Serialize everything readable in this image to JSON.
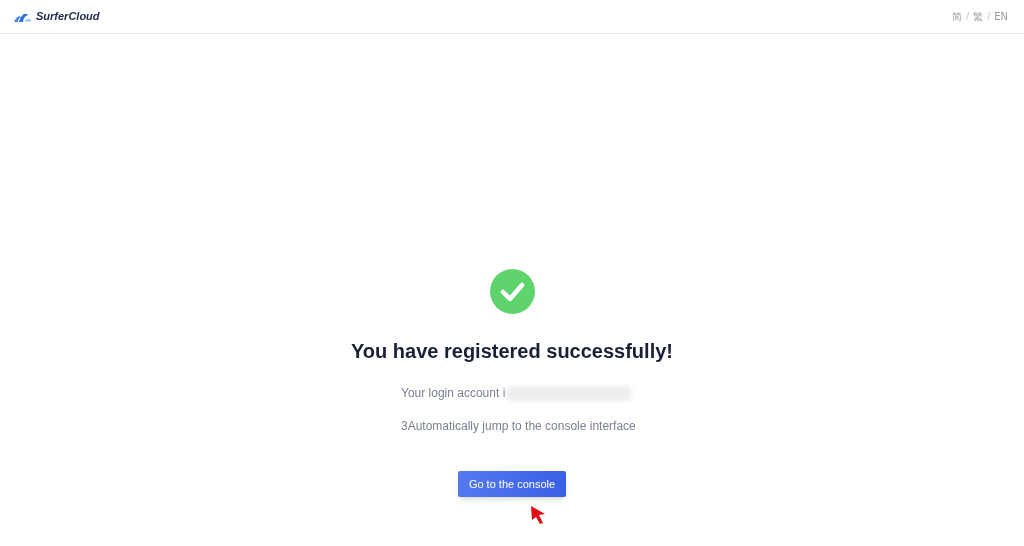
{
  "header": {
    "logo_text": "SurferCloud",
    "languages": [
      {
        "kind": "option",
        "label": "简"
      },
      {
        "kind": "separator",
        "label": "/"
      },
      {
        "kind": "option",
        "label": "繁"
      },
      {
        "kind": "separator",
        "label": "/"
      },
      {
        "kind": "option",
        "label": "EN"
      }
    ]
  },
  "result": {
    "title": "You have registered successfully!",
    "account_label": "Your login account i",
    "redirect_text": "3Automatically jump to the console interface",
    "button": "Go to the console"
  }
}
